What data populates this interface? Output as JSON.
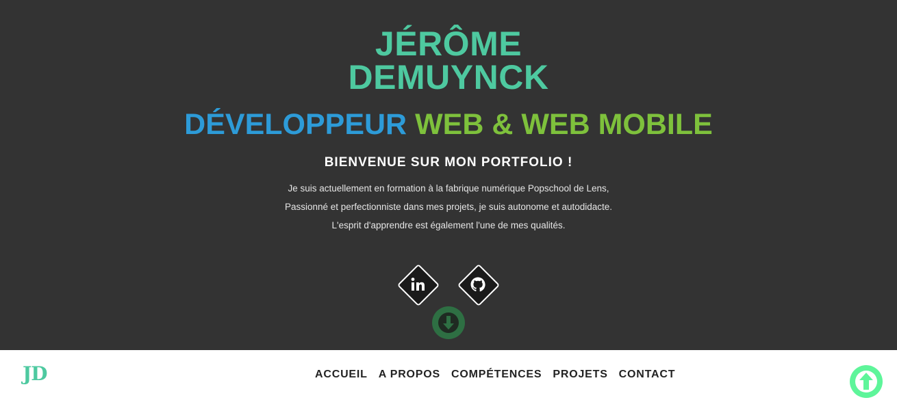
{
  "hero": {
    "name_line1": "JÉRÔME",
    "name_line2": "DEMUYNCK",
    "role_part1": "DÉVELOPPEUR",
    "role_part2": "WEB & WEB MOBILE",
    "welcome": "BIENVENUE SUR MON PORTFOLIO !",
    "bio_lines": [
      "Je suis actuellement en formation à la fabrique numérique Popschool de Lens,",
      "Passionné et perfectionniste dans mes projets, je suis autonome et autodidacte.",
      "L'esprit d'apprendre est également l'une de mes qualités."
    ],
    "social_icons": [
      "linkedin-icon",
      "github-icon"
    ],
    "scroll_down_icon": "arrow-down-icon"
  },
  "navbar": {
    "logo": "JD",
    "items": [
      {
        "label": "ACCUEIL"
      },
      {
        "label": "A PROPOS"
      },
      {
        "label": "COMPÉTENCES"
      },
      {
        "label": "PROJETS"
      },
      {
        "label": "CONTACT"
      }
    ]
  },
  "back_to_top_icon": "arrow-up-icon",
  "colors": {
    "background_dark": "#333333",
    "accent_teal": "#4ec9a0",
    "accent_blue": "#2d9bd8",
    "accent_green": "#7ec13c",
    "scroll_down_green": "#2e6f43",
    "back_to_top_green": "#5ef59a"
  }
}
